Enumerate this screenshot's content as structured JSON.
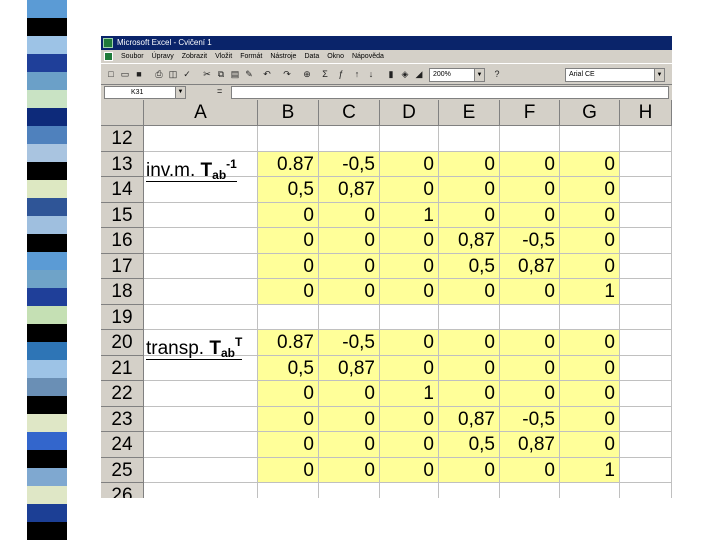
{
  "window": {
    "title": "Microsoft Excel - Cvičení 1"
  },
  "menu": [
    "Soubor",
    "Úpravy",
    "Zobrazit",
    "Vložit",
    "Formát",
    "Nástroje",
    "Data",
    "Okno",
    "Nápověda"
  ],
  "toolbar": {
    "zoom": "200%",
    "font": "Arial CE"
  },
  "formula_bar": {
    "name_box": "K31",
    "equals": "=",
    "formula": ""
  },
  "sheet": {
    "columns": [
      "A",
      "B",
      "C",
      "D",
      "E",
      "F",
      "G",
      "H"
    ],
    "label_inv": "inv.m.",
    "label_inv_T": "T",
    "label_inv_sub": "ab",
    "label_inv_sup": "-1",
    "label_transp": "transp.",
    "label_transp_T": "T",
    "label_transp_sub": "ab",
    "label_transp_sup": "T",
    "rows": [
      {
        "num": "12",
        "vals": [
          "",
          "",
          "",
          "",
          "",
          "",
          ""
        ]
      },
      {
        "num": "13",
        "vals": [
          "0.87",
          "-0,5",
          "0",
          "0",
          "0",
          "0",
          ""
        ]
      },
      {
        "num": "14",
        "vals": [
          "0,5",
          "0,87",
          "0",
          "0",
          "0",
          "0",
          ""
        ]
      },
      {
        "num": "15",
        "vals": [
          "0",
          "0",
          "1",
          "0",
          "0",
          "0",
          ""
        ]
      },
      {
        "num": "16",
        "vals": [
          "0",
          "0",
          "0",
          "0,87",
          "-0,5",
          "0",
          ""
        ]
      },
      {
        "num": "17",
        "vals": [
          "0",
          "0",
          "0",
          "0,5",
          "0,87",
          "0",
          ""
        ]
      },
      {
        "num": "18",
        "vals": [
          "0",
          "0",
          "0",
          "0",
          "0",
          "1",
          ""
        ]
      },
      {
        "num": "19",
        "vals": [
          "",
          "",
          "",
          "",
          "",
          "",
          ""
        ]
      },
      {
        "num": "20",
        "vals": [
          "0.87",
          "-0,5",
          "0",
          "0",
          "0",
          "0",
          ""
        ]
      },
      {
        "num": "21",
        "vals": [
          "0,5",
          "0,87",
          "0",
          "0",
          "0",
          "0",
          ""
        ]
      },
      {
        "num": "22",
        "vals": [
          "0",
          "0",
          "1",
          "0",
          "0",
          "0",
          ""
        ]
      },
      {
        "num": "23",
        "vals": [
          "0",
          "0",
          "0",
          "0,87",
          "-0,5",
          "0",
          ""
        ]
      },
      {
        "num": "24",
        "vals": [
          "0",
          "0",
          "0",
          "0,5",
          "0,87",
          "0",
          ""
        ]
      },
      {
        "num": "25",
        "vals": [
          "0",
          "0",
          "0",
          "0",
          "0",
          "1",
          ""
        ]
      },
      {
        "num": "26",
        "vals": [
          "",
          "",
          "",
          "",
          "",
          "",
          ""
        ]
      }
    ]
  },
  "colors": {
    "highlight": "#ffff99",
    "title_bar": "#0a246a",
    "chrome": "#d4d0c8"
  }
}
